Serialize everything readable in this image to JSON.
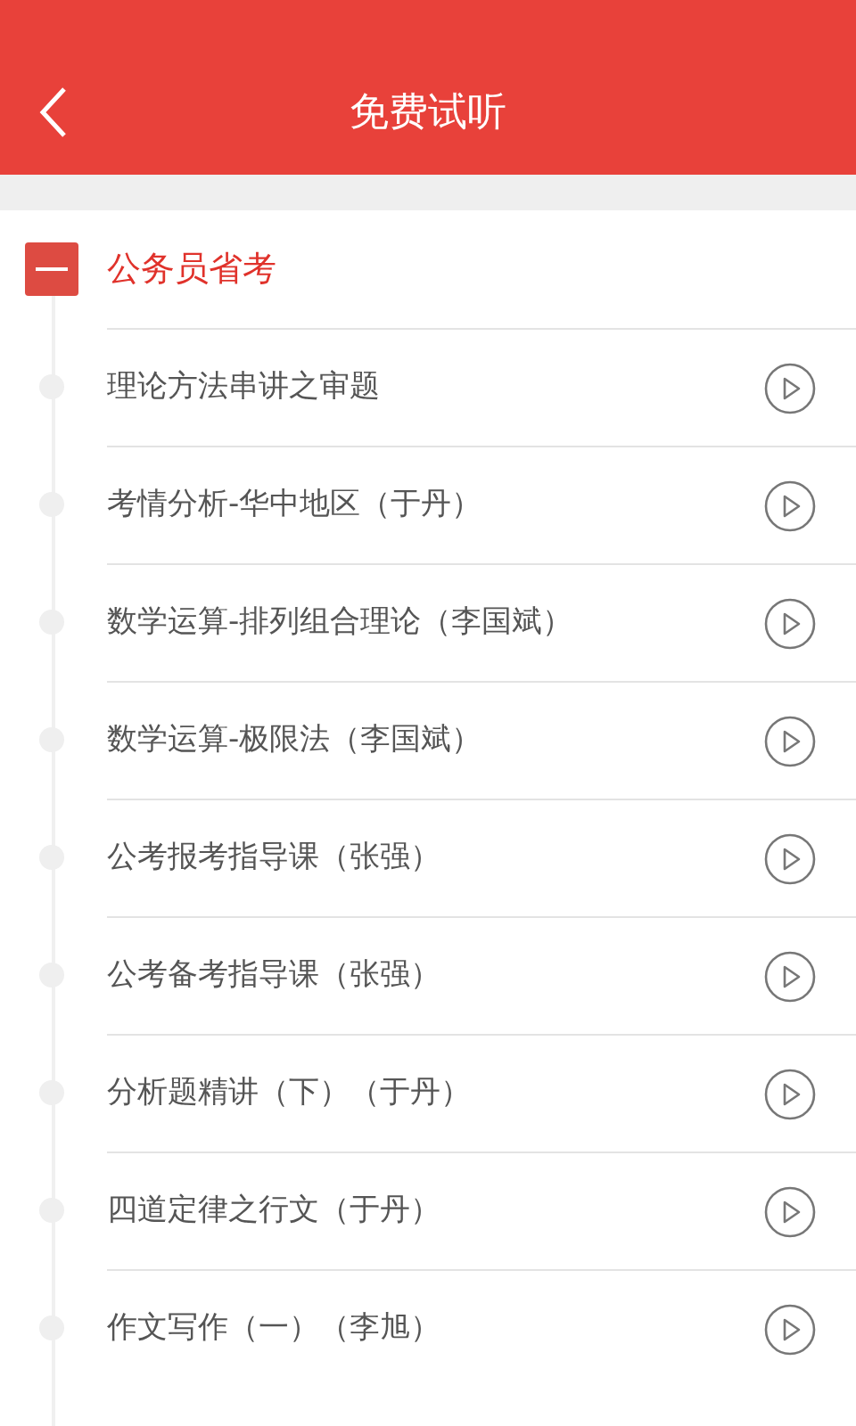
{
  "header": {
    "title": "免费试听"
  },
  "section": {
    "title": "公务员省考",
    "expanded": true,
    "lessons": [
      {
        "title": "理论方法串讲之审题"
      },
      {
        "title": "考情分析-华中地区（于丹）"
      },
      {
        "title": "数学运算-排列组合理论（李国斌）"
      },
      {
        "title": "数学运算-极限法（李国斌）"
      },
      {
        "title": "公考报考指导课（张强）"
      },
      {
        "title": "公考备考指导课（张强）"
      },
      {
        "title": "分析题精讲（下）（于丹）"
      },
      {
        "title": "四道定律之行文（于丹）"
      },
      {
        "title": "作文写作（一）（李旭）"
      }
    ]
  }
}
